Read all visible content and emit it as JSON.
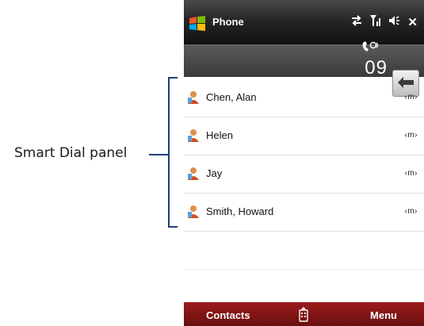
{
  "annotation": {
    "label": "Smart Dial panel"
  },
  "titlebar": {
    "title": "Phone",
    "status_icons": [
      "connectivity-icon",
      "signal-icon",
      "volume-icon",
      "close-icon"
    ],
    "close_glyph": "✕"
  },
  "dial": {
    "digits": "09"
  },
  "contacts": [
    {
      "name": "Chen, Alan",
      "indicator": "‹m›"
    },
    {
      "name": "Helen",
      "indicator": "‹m›"
    },
    {
      "name": "Jay",
      "indicator": "‹m›"
    },
    {
      "name": "Smith, Howard",
      "indicator": "‹m›"
    }
  ],
  "softkeys": {
    "left": "Contacts",
    "right": "Menu"
  },
  "colors": {
    "softbar": "#8a1414",
    "bracket": "#1e3f7a",
    "titlebar": "#262626"
  }
}
